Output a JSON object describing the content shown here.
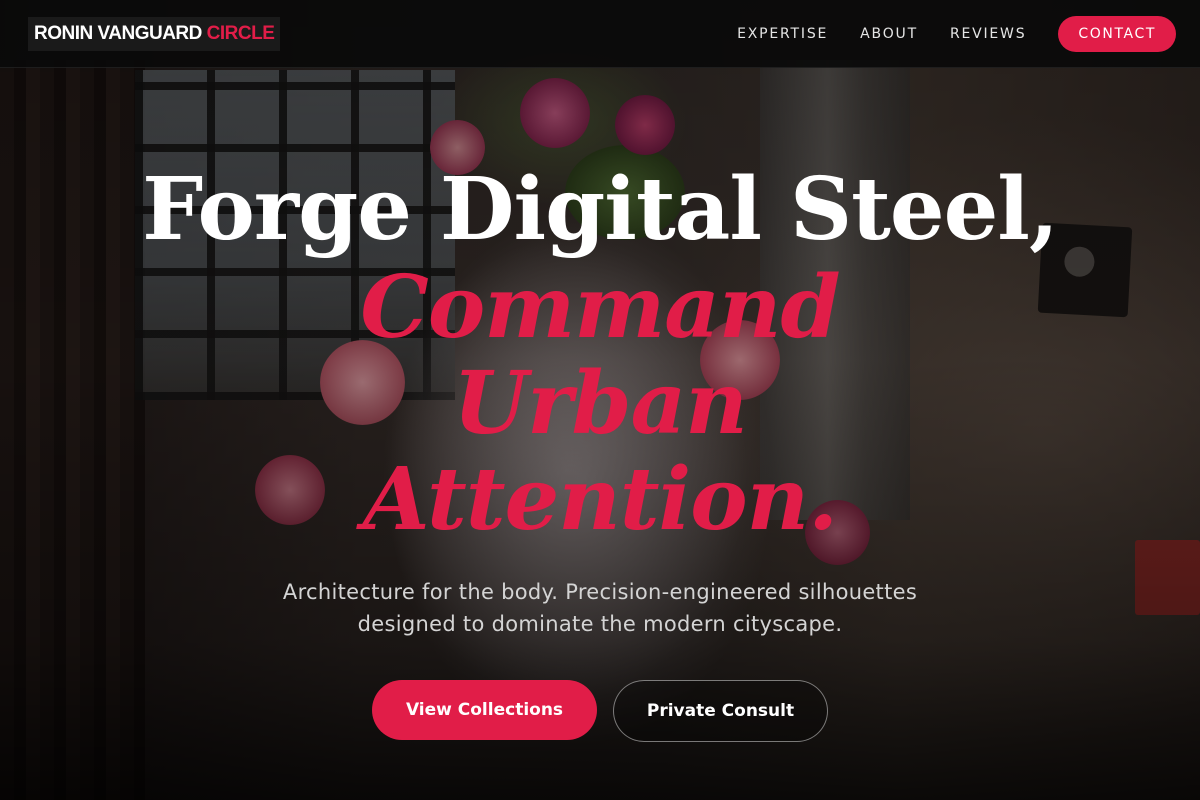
{
  "nav": {
    "logo_main": "RONIN VANGUARD",
    "logo_accent": "CIRCLE",
    "links": [
      "EXPERTISE",
      "ABOUT",
      "REVIEWS"
    ],
    "cta": "CONTACT"
  },
  "hero": {
    "headline_line1": "Forge Digital Steel,",
    "headline_line2": "Command Urban Attention.",
    "subtitle": "Architecture for the body. Precision-engineered silhouettes designed to dominate the modern cityscape.",
    "primary_button": "View Collections",
    "secondary_button": "Private Consult"
  },
  "colors": {
    "accent": "#e11d48",
    "nav_background": "#0a0a0a",
    "text_primary": "#ffffff"
  }
}
